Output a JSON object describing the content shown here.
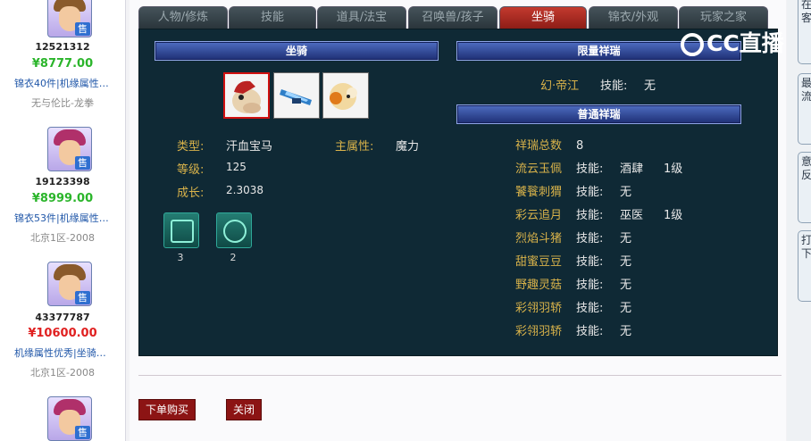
{
  "listings": [
    {
      "id": "12521312",
      "price": "¥8777.00",
      "price_color": "#2bb52b",
      "desc": "锦衣40件|机缘属性…",
      "server": "无与伦比-龙拳",
      "hair": "#8a5a2b"
    },
    {
      "id": "19123398",
      "price": "¥8999.00",
      "price_color": "#2bb52b",
      "desc": "锦衣53件|机缘属性…",
      "server": "北京1区-2008",
      "hair": "#b0306a"
    },
    {
      "id": "43377787",
      "price": "¥10600.00",
      "price_color": "#e02020",
      "desc": "机缘属性优秀|坐骑…",
      "server": "北京1区-2008",
      "hair": "#8a5a2b"
    },
    {
      "hair": "#b0306a"
    }
  ],
  "sell_badge": "售",
  "tabs": [
    "人物/修炼",
    "技能",
    "道具/法宝",
    "召唤兽/孩子",
    "坐骑",
    "锦衣/外观",
    "玩家之家"
  ],
  "active_tab": "坐骑",
  "mount": {
    "header": "坐骑",
    "type_label": "类型:",
    "type_value": "汗血宝马",
    "main_attr_label": "主属性:",
    "main_attr_value": "魔力",
    "level_label": "等级:",
    "level_value": "125",
    "growth_label": "成长:",
    "growth_value": "2.3038",
    "skills": [
      {
        "icon": "mount-skill-icon-1",
        "level": "3"
      },
      {
        "icon": "mount-skill-icon-2",
        "level": "2"
      }
    ]
  },
  "limited": {
    "header": "限量祥瑞",
    "name": "幻·帝江",
    "skill_label": "技能:",
    "skill_value": "无"
  },
  "normal": {
    "header": "普通祥瑞",
    "total_label": "祥瑞总数",
    "total_value": "8",
    "items": [
      {
        "name": "流云玉佩",
        "skill_label": "技能:",
        "skill": "酒肆",
        "level": "1级"
      },
      {
        "name": "饕餮刺猬",
        "skill_label": "技能:",
        "skill": "无",
        "level": ""
      },
      {
        "name": "彩云追月",
        "skill_label": "技能:",
        "skill": "巫医",
        "level": "1级"
      },
      {
        "name": "烈焰斗猪",
        "skill_label": "技能:",
        "skill": "无",
        "level": ""
      },
      {
        "name": "甜蜜豆豆",
        "skill_label": "技能:",
        "skill": "无",
        "level": ""
      },
      {
        "name": "野趣灵菇",
        "skill_label": "技能:",
        "skill": "无",
        "level": ""
      },
      {
        "name": "彩翎羽轿",
        "skill_label": "技能:",
        "skill": "无",
        "level": ""
      },
      {
        "name": "彩翎羽轿",
        "skill_label": "技能:",
        "skill": "无",
        "level": ""
      }
    ]
  },
  "buttons": {
    "buy": "下单购买",
    "close": "关闭"
  },
  "watermark": "CC直播",
  "right_tabs": [
    "在客",
    "最流",
    "意反",
    "打下"
  ],
  "colors": {
    "panel_bg": "#0f2935",
    "label_gold": "#d8b24a",
    "active_tab": "#c33a2f",
    "button": "#8c1414"
  }
}
